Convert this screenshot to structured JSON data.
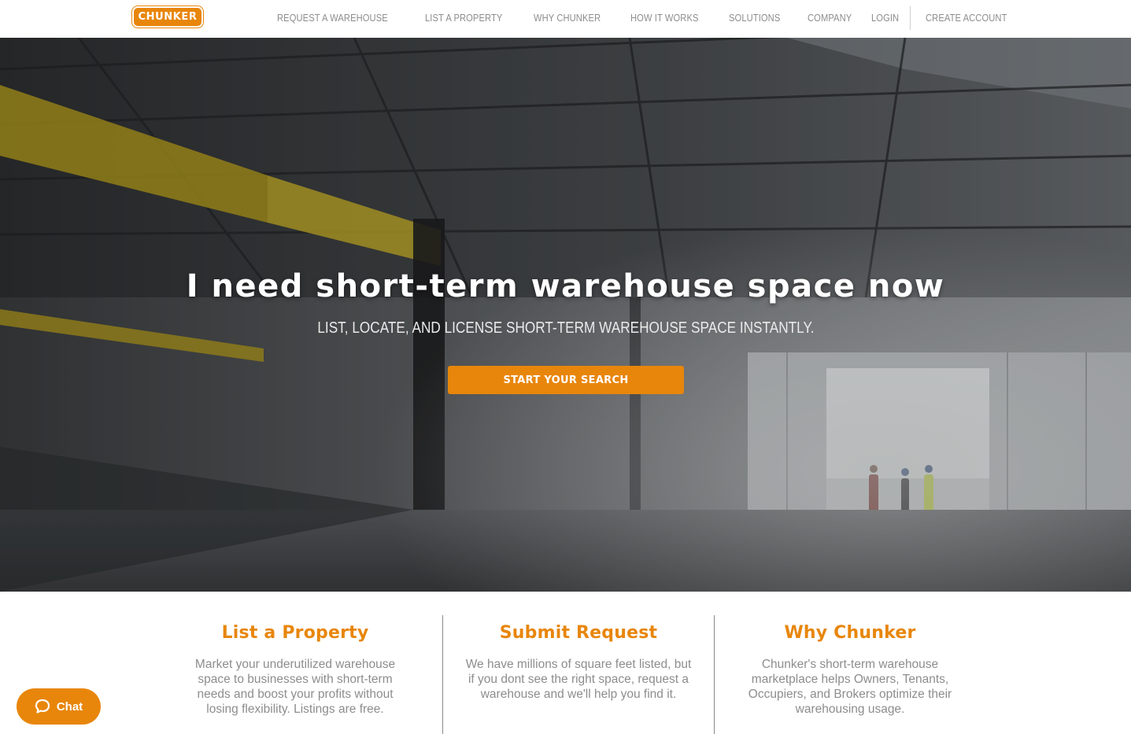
{
  "brand": {
    "logo_text": "CHUNKER",
    "accent_color": "#e8860b"
  },
  "nav": {
    "main": [
      {
        "label": "REQUEST A WAREHOUSE"
      },
      {
        "label": "LIST A PROPERTY"
      },
      {
        "label": "WHY CHUNKER"
      },
      {
        "label": "HOW IT WORKS"
      },
      {
        "label": "SOLUTIONS"
      },
      {
        "label": "COMPANY"
      }
    ],
    "login_label": "LOGIN",
    "create_account_label": "CREATE ACCOUNT"
  },
  "hero": {
    "title": "I need short-term warehouse space now",
    "subtitle": "LIST, LOCATE, AND LICENSE SHORT-TERM WAREHOUSE SPACE INSTANTLY.",
    "cta_label": "START YOUR SEARCH"
  },
  "features": [
    {
      "title": "List a Property",
      "text": "Market your underutilized warehouse space to businesses with short-term needs and boost your profits without losing flexibility. Listings are free."
    },
    {
      "title": "Submit Request",
      "text": "We have millions of square feet listed, but if you dont see the right space, request a warehouse and we'll help you find it."
    },
    {
      "title": "Why Chunker",
      "text": "Chunker's short-term warehouse marketplace helps Owners, Tenants, Occupiers, and Brokers optimize their warehousing usage."
    }
  ],
  "chat": {
    "label": "Chat",
    "icon": "chat-bubble-icon"
  }
}
